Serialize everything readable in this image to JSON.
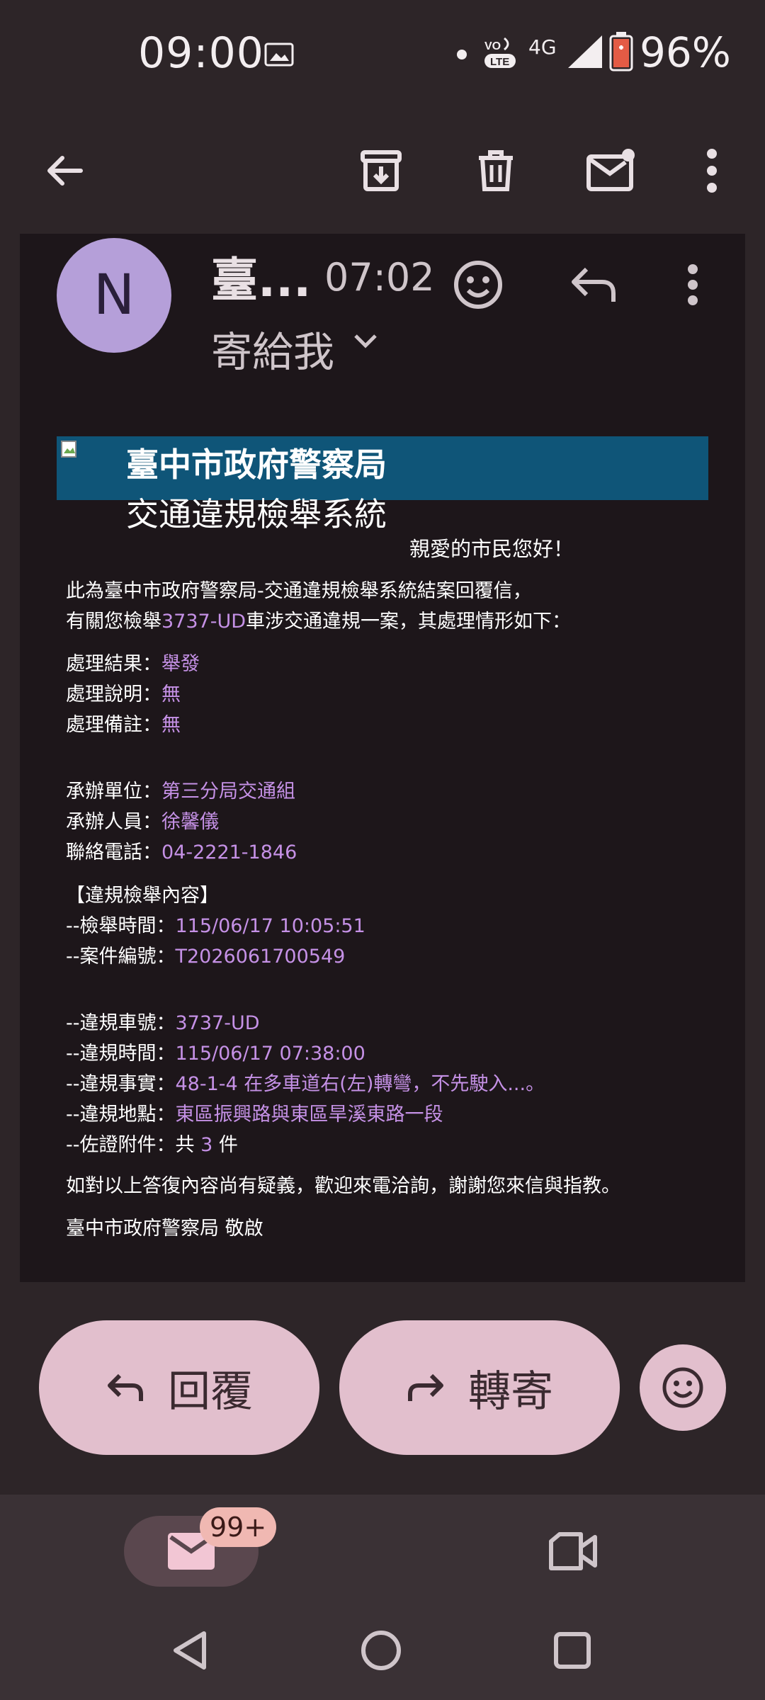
{
  "status_bar": {
    "time": "09:00",
    "network": "4G",
    "battery": "96%",
    "icons": [
      "image-icon",
      "dot-icon",
      "volte-icon",
      "signal-icon",
      "battery-icon"
    ]
  },
  "toolbar": {
    "icons": [
      "back-arrow-icon",
      "archive-icon",
      "delete-icon",
      "mark-unread-icon",
      "more-vert-icon"
    ]
  },
  "email": {
    "avatar_letter": "N",
    "sender": "臺...",
    "time": "07:02",
    "to": "寄給我",
    "banner_title": "臺中市政府警察局",
    "banner_subtitle": "交通違規檢舉系統",
    "greeting": "親愛的市民您好！",
    "intro_line1": "此為臺中市政府警察局-交通違規檢舉系統結案回覆信，",
    "intro_line2_pre": "有關您檢舉",
    "intro_plate": "3737-UD",
    "intro_line2_post": "車涉交通違規一案，其處理情形如下：",
    "fields": {
      "result_label": "處理結果：",
      "result_value": "舉發",
      "explain_label": "處理說明：",
      "explain_value": "無",
      "note_label": "處理備註：",
      "note_value": "無",
      "unit_label": "承辦單位：",
      "unit_value": "第三分局交通組",
      "staff_label": "承辦人員：",
      "staff_value": "徐馨儀",
      "phone_label": "聯絡電話：",
      "phone_value": "04-2221-1846",
      "section_title": "【違規檢舉內容】",
      "report_time_label": "--檢舉時間：",
      "report_time_value": "115/06/17 10:05:51",
      "case_no_label": "--案件編號：",
      "case_no_value": "T2026061700549",
      "plate_label": "--違規車號：",
      "plate_value": "3737-UD",
      "viol_time_label": "--違規時間：",
      "viol_time_value": "115/06/17 07:38:00",
      "fact_label": "--違規事實：",
      "fact_value": "48-1-4 在多車道右(左)轉彎，不先駛入...。",
      "place_label": "--違規地點：",
      "place_value": "東區振興路與東區旱溪東路一段",
      "attach_label": "--佐證附件：",
      "attach_pre": "共 ",
      "attach_count": "3",
      "attach_post": " 件"
    },
    "closing": "如對以上答復內容尚有疑義，歡迎來電洽詢，謝謝您來信與指教。",
    "signature": "臺中市政府警察局 敬啟"
  },
  "actions": {
    "reply": "回覆",
    "forward": "轉寄"
  },
  "bottom_nav": {
    "mail_badge": "99+"
  }
}
